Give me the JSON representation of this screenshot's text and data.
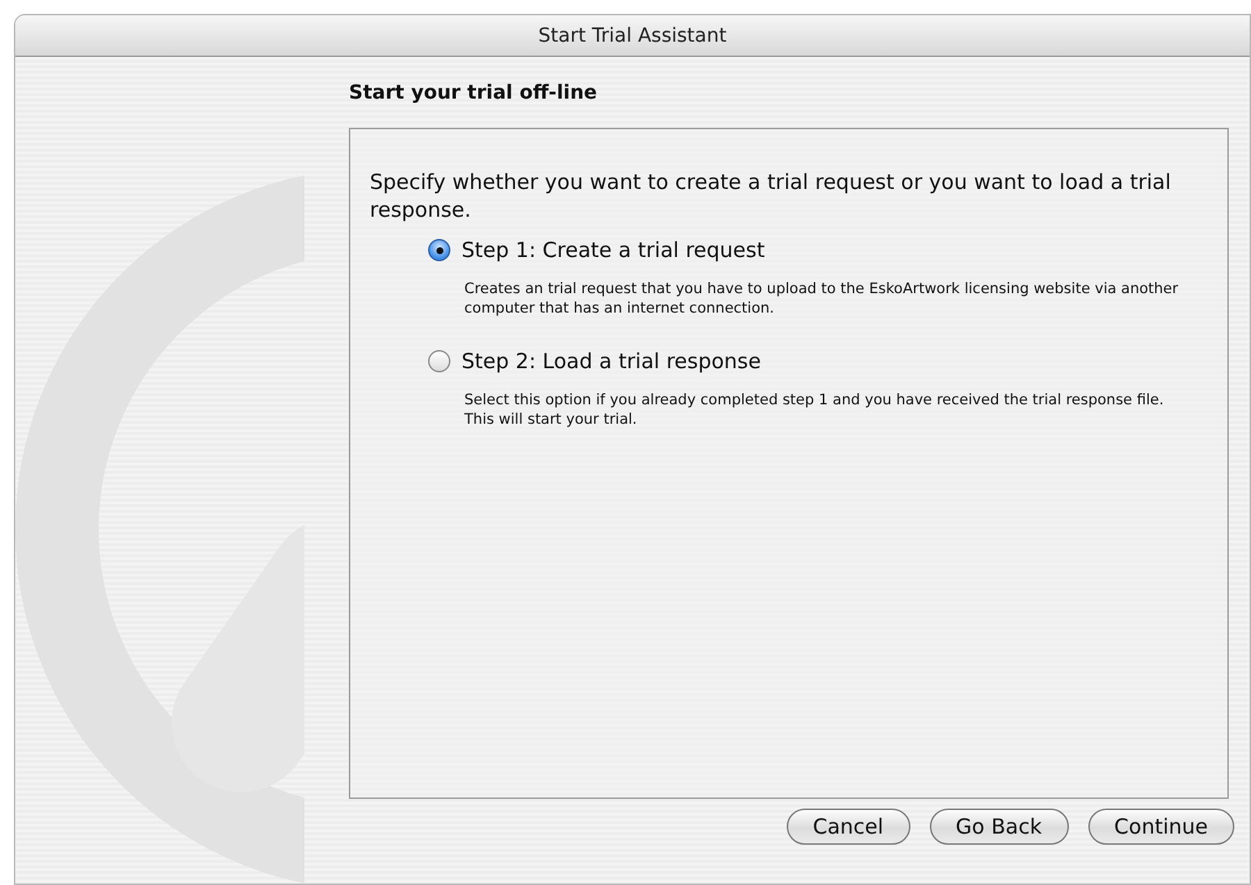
{
  "window": {
    "title": "Start Trial Assistant"
  },
  "heading": "Start your trial off-line",
  "intro": "Specify whether you want to create a trial request or you want to load a trial response.",
  "options": [
    {
      "label": "Step 1: Create a trial request",
      "description": "Creates an trial request that you have to upload to the EskoArtwork licensing website via another computer that has an internet connection.",
      "selected": true
    },
    {
      "label": "Step 2: Load a trial response",
      "description": "Select this option if you already completed step 1 and you have received the trial response file. This will start your trial.",
      "selected": false
    }
  ],
  "buttons": [
    "Cancel",
    "Go Back",
    "Continue"
  ]
}
